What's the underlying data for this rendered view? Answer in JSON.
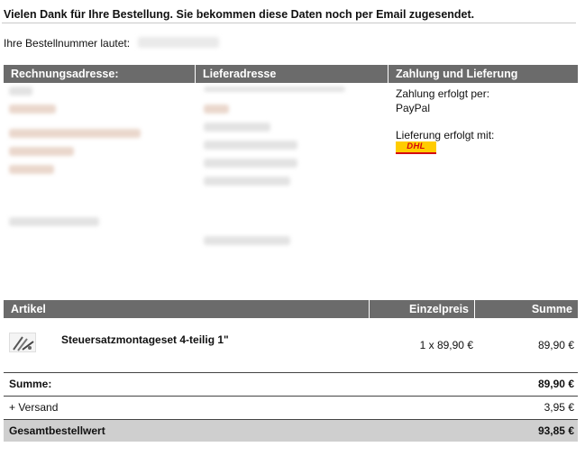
{
  "header": {
    "title": "Vielen Dank für Ihre Bestellung. Sie bekommen diese Daten noch per Email zugesendet.",
    "order_number_label": "Ihre Bestellnummer lautet:"
  },
  "addresses": {
    "columns": [
      "Rechnungsadresse:",
      "Lieferadresse",
      "Zahlung und Lieferung"
    ],
    "payment_label": "Zahlung erfolgt per:",
    "payment_value": "PayPal",
    "shipping_label": "Lieferung erfolgt mit:",
    "carrier_logo": "DHL"
  },
  "articles": {
    "columns": [
      "Artikel",
      "Einzelpreis",
      "Summe"
    ],
    "items": [
      {
        "name": "Steuersatzmontageset 4-teilig 1\"",
        "unit_price": "1 x 89,90 €",
        "sum": "89,90 €"
      }
    ]
  },
  "totals": {
    "subtotal_label": "Summe:",
    "subtotal_value": "89,90 €",
    "shipping_label": "+ Versand",
    "shipping_value": "3,95 €",
    "grand_label": "Gesamtbestellwert",
    "grand_value": "93,85 €"
  },
  "colors": {
    "header_bar": "#6b6b6b",
    "grand_total_bg": "#cfcfcf",
    "dhl_yellow": "#ffcc00",
    "dhl_red": "#d40511"
  }
}
